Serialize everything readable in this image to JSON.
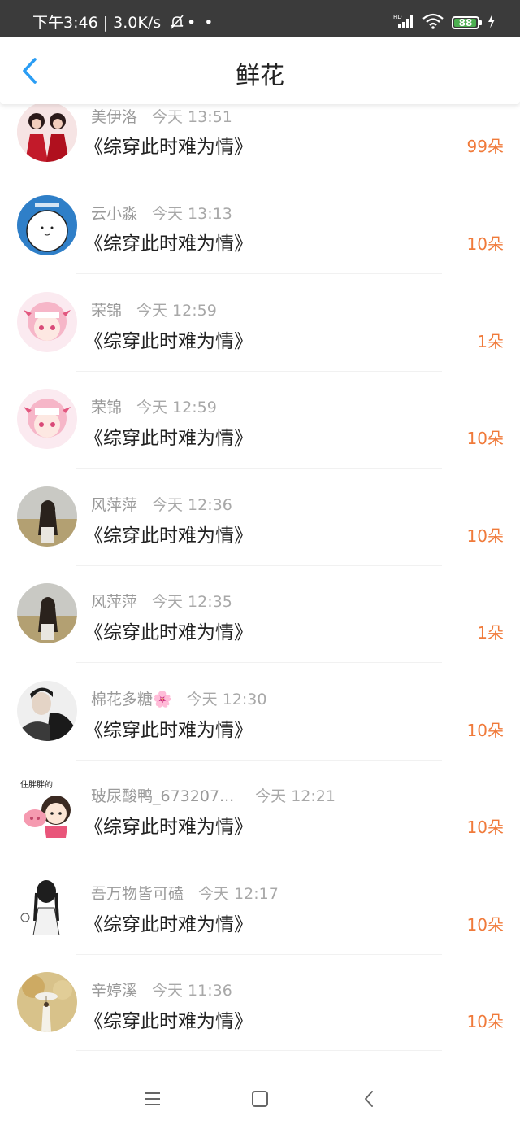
{
  "status": {
    "left": "下午3:46 | 3.0K/s",
    "dots": "• •",
    "battery": "88"
  },
  "header": {
    "title": "鲜花"
  },
  "rows": [
    {
      "name": "美伊洛",
      "time": "今天 13:51",
      "book": "《综穿此时难为情》",
      "count": "99朵"
    },
    {
      "name": "云小淼",
      "time": "今天 13:13",
      "book": "《综穿此时难为情》",
      "count": "10朵"
    },
    {
      "name": "荣锦",
      "time": "今天 12:59",
      "book": "《综穿此时难为情》",
      "count": "1朵"
    },
    {
      "name": "荣锦",
      "time": "今天 12:59",
      "book": "《综穿此时难为情》",
      "count": "10朵"
    },
    {
      "name": "风萍萍",
      "time": "今天 12:36",
      "book": "《综穿此时难为情》",
      "count": "10朵"
    },
    {
      "name": "风萍萍",
      "time": "今天 12:35",
      "book": "《综穿此时难为情》",
      "count": "1朵"
    },
    {
      "name": "棉花多糖🌸",
      "time": "今天 12:30",
      "book": "《综穿此时难为情》",
      "count": "10朵"
    },
    {
      "name": "玻尿酸鸭_673207...",
      "time": "今天 12:21",
      "book": "《综穿此时难为情》",
      "count": "10朵"
    },
    {
      "name": "吾万物皆可磕",
      "time": "今天 12:17",
      "book": "《综穿此时难为情》",
      "count": "10朵"
    },
    {
      "name": "辛婷溪",
      "time": "今天 11:36",
      "book": "《综穿此时难为情》",
      "count": "10朵"
    }
  ],
  "avatar_sticker_text": "住胖胖的",
  "colors": {
    "accent": "#2a9df4",
    "count": "#f07a3a"
  }
}
